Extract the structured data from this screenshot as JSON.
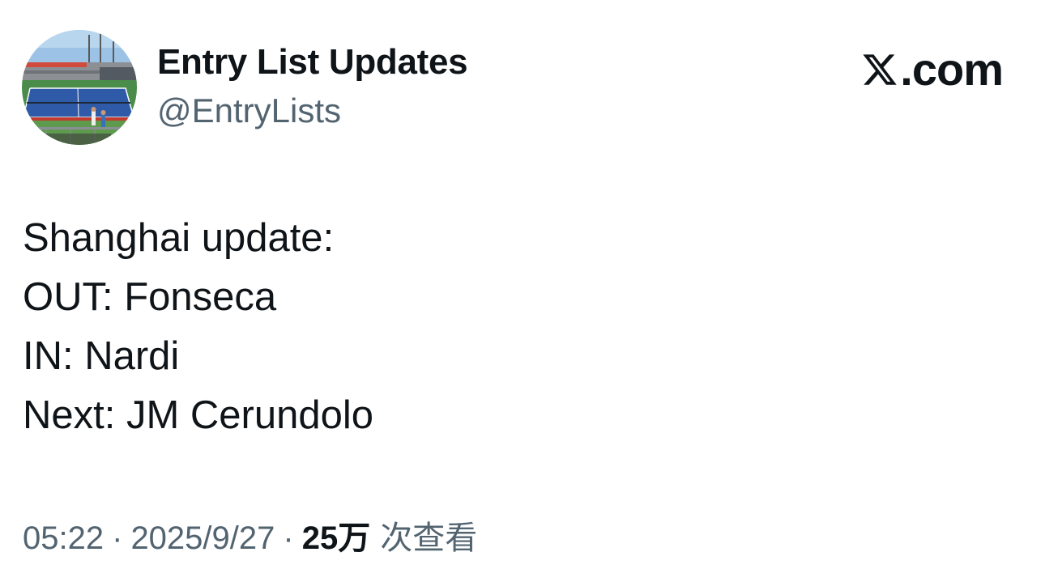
{
  "author": {
    "display_name": "Entry List Updates",
    "handle": "@EntryLists",
    "avatar_icon": "tennis-court-avatar"
  },
  "brand": {
    "logo_icon": "x-logo-icon",
    "suffix": ".com"
  },
  "tweet": {
    "lines": [
      "Shanghai update:",
      "OUT: Fonseca",
      "IN: Nardi",
      "Next: JM Cerundolo"
    ]
  },
  "meta": {
    "time": "05:22",
    "separator": "·",
    "date": "2025/9/27",
    "views_count": "25万",
    "views_label": "次查看"
  },
  "colors": {
    "text_primary": "#0f1419",
    "text_secondary": "#536471",
    "background": "#ffffff"
  }
}
